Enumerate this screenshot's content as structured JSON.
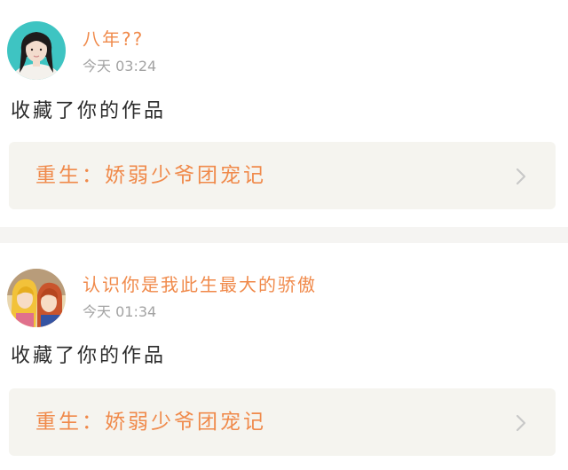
{
  "feed": {
    "items": [
      {
        "username": "八年??",
        "timestamp": "今天 03:24",
        "action": "收藏了你的作品",
        "work_title": "重生：娇弱少爷团宠记",
        "avatar_icon": "girl-portrait-avatar",
        "chevron_icon": "chevron-right-icon"
      },
      {
        "username": "认识你是我此生最大的骄傲",
        "timestamp": "今天 01:34",
        "action": "收藏了你的作品",
        "work_title": "重生：娇弱少爷团宠记",
        "avatar_icon": "anime-couple-avatar",
        "chevron_icon": "chevron-right-icon"
      }
    ]
  },
  "colors": {
    "accent": "#f08a4b",
    "secondary_text": "#a3a3a3",
    "primary_text": "#2b2b2b",
    "link_card_bg": "#f5f4ef",
    "separator": "#f5f4f2",
    "chevron": "#c8c8c8"
  }
}
